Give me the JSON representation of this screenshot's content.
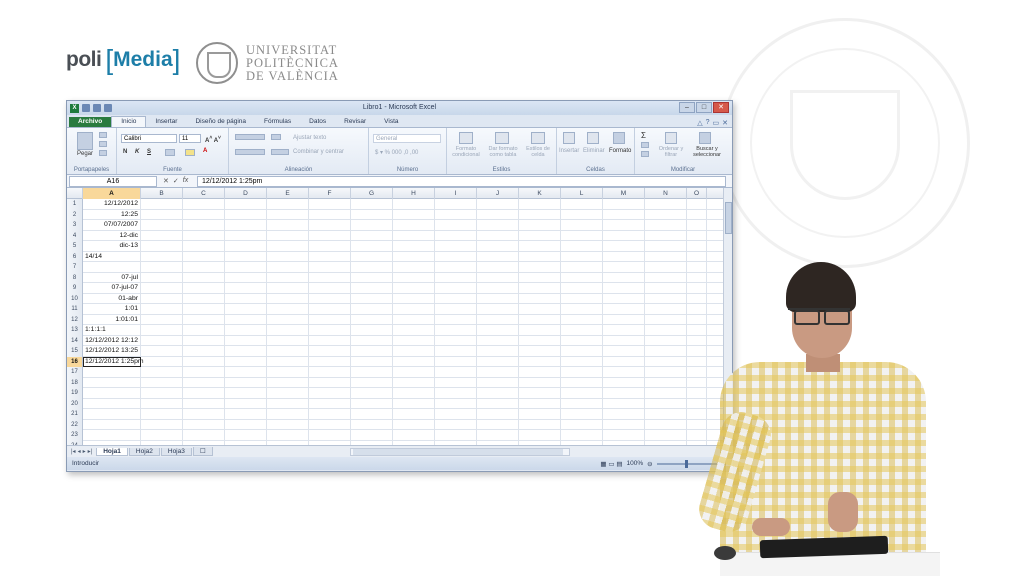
{
  "branding": {
    "poli": "poli",
    "media": "Media",
    "university_lines": [
      "UNIVERSITAT",
      "POLITÈCNICA",
      "DE VALÈNCIA"
    ]
  },
  "window": {
    "title": "Libro1 - Microsoft Excel",
    "tabs": [
      "Archivo",
      "Inicio",
      "Insertar",
      "Diseño de página",
      "Fórmulas",
      "Datos",
      "Revisar",
      "Vista"
    ],
    "active_tab": "Inicio"
  },
  "ribbon": {
    "clipboard": {
      "paste": "Pegar",
      "label": "Portapapeles"
    },
    "font": {
      "name": "Calibri",
      "size": "11",
      "label": "Fuente",
      "bold": "N",
      "italic": "K",
      "underline": "S"
    },
    "alignment": {
      "wrap": "Ajustar texto",
      "merge": "Combinar y centrar",
      "label": "Alineación"
    },
    "number": {
      "format": "General",
      "label": "Número"
    },
    "styles": {
      "conditional": "Formato condicional",
      "as_table": "Dar formato como tabla",
      "cell_styles": "Estilos de celda",
      "label": "Estilos"
    },
    "cells": {
      "insert": "Insertar",
      "delete": "Eliminar",
      "format": "Formato",
      "label": "Celdas"
    },
    "editing": {
      "sort": "Ordenar y filtrar",
      "find": "Buscar y seleccionar",
      "label": "Modificar"
    }
  },
  "formula_bar": {
    "name_box": "A16",
    "fx": "fx",
    "content": "12/12/2012 1:25pm"
  },
  "columns": [
    "A",
    "B",
    "C",
    "D",
    "E",
    "F",
    "G",
    "H",
    "I",
    "J",
    "K",
    "L",
    "M",
    "N",
    "O"
  ],
  "selected_column": "A",
  "rows": [
    {
      "n": "1",
      "a": "12/12/2012",
      "align": "r"
    },
    {
      "n": "2",
      "a": "12:25",
      "align": "r"
    },
    {
      "n": "3",
      "a": "07/07/2007",
      "align": "r"
    },
    {
      "n": "4",
      "a": "12-dic",
      "align": "r"
    },
    {
      "n": "5",
      "a": "dic-13",
      "align": "r"
    },
    {
      "n": "6",
      "a": "14/14",
      "align": "l"
    },
    {
      "n": "7",
      "a": "",
      "align": "l"
    },
    {
      "n": "8",
      "a": "07-jul",
      "align": "r"
    },
    {
      "n": "9",
      "a": "07-jul-07",
      "align": "r"
    },
    {
      "n": "10",
      "a": "01-abr",
      "align": "r"
    },
    {
      "n": "11",
      "a": "1:01",
      "align": "r"
    },
    {
      "n": "12",
      "a": "1:01:01",
      "align": "r"
    },
    {
      "n": "13",
      "a": "1:1:1:1",
      "align": "l"
    },
    {
      "n": "14",
      "a": "12/12/2012 12:12",
      "align": "r"
    },
    {
      "n": "15",
      "a": "12/12/2012 13:25",
      "align": "r"
    },
    {
      "n": "16",
      "a": "12/12/2012 1:25pm",
      "align": "l"
    },
    {
      "n": "17",
      "a": "",
      "align": "l"
    },
    {
      "n": "18",
      "a": "",
      "align": "l"
    },
    {
      "n": "19",
      "a": "",
      "align": "l"
    },
    {
      "n": "20",
      "a": "",
      "align": "l"
    },
    {
      "n": "21",
      "a": "",
      "align": "l"
    },
    {
      "n": "22",
      "a": "",
      "align": "l"
    },
    {
      "n": "23",
      "a": "",
      "align": "l"
    },
    {
      "n": "24",
      "a": "",
      "align": "l"
    }
  ],
  "selected_row": "16",
  "sheets": [
    "Hoja1",
    "Hoja2",
    "Hoja3"
  ],
  "active_sheet": "Hoja1",
  "status": {
    "mode": "Introducir",
    "zoom": "100%"
  }
}
